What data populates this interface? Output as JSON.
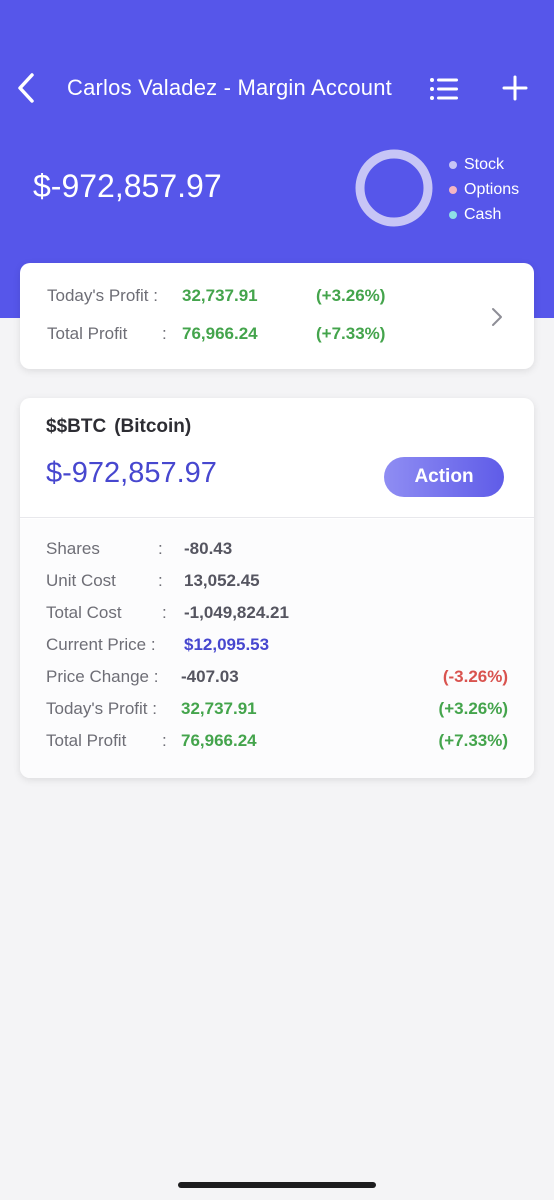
{
  "header": {
    "title": "Carlos Valadez - Margin Account",
    "balance": "$-972,857.97",
    "legend": [
      {
        "label": "Stock",
        "color": "#c7c5f6"
      },
      {
        "label": "Options",
        "color": "#f3b6c4"
      },
      {
        "label": "Cash",
        "color": "#8ee0e6"
      }
    ]
  },
  "summary": {
    "todays_profit": {
      "label": "Today's Profit :",
      "value": "32,737.91",
      "pct": "(+3.26%)"
    },
    "total_profit": {
      "label": "Total Profit",
      "colon": ":",
      "value": "76,966.24",
      "pct": "(+7.33%)"
    }
  },
  "position": {
    "symbol": "$$BTC",
    "name": "(Bitcoin)",
    "market_value": "$-972,857.97",
    "action_label": "Action",
    "rows": [
      {
        "label": "Shares",
        "colon": ":",
        "value": "-80.43",
        "pct": ""
      },
      {
        "label": "Unit Cost",
        "colon": ":",
        "value": "13,052.45",
        "pct": ""
      },
      {
        "label": "Total Cost",
        "colon": ":",
        "value": "-1,049,824.21",
        "pct": ""
      },
      {
        "label": "Current Price :",
        "colon": "",
        "value": "$12,095.53",
        "pct": ""
      },
      {
        "label": "Price Change :",
        "colon": "",
        "value": "-407.03",
        "pct": "(-3.26%)"
      },
      {
        "label": "Today's Profit :",
        "colon": "",
        "value": "32,737.91",
        "pct": "(+3.26%)"
      },
      {
        "label": "Total Profit",
        "colon": ":",
        "value": "76,966.24",
        "pct": "(+7.33%)"
      }
    ]
  },
  "colors": {
    "header_bg": "#5656ea",
    "positive": "#44a44c",
    "negative": "#d9534f",
    "accent": "#4747cf"
  }
}
